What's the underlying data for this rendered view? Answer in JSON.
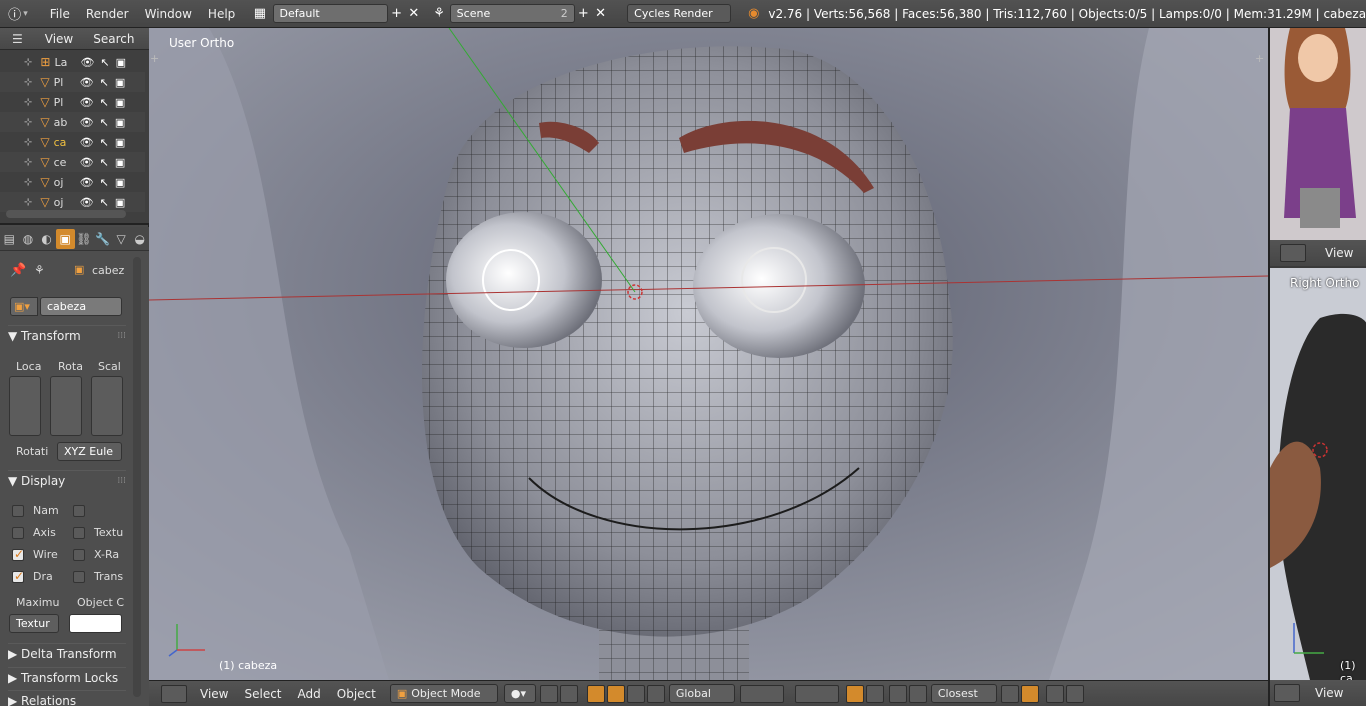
{
  "topbar": {
    "info_icon": "info-icon",
    "menus": [
      "File",
      "Render",
      "Window",
      "Help"
    ],
    "screen_layout": "Default",
    "scene": "Scene",
    "scene_users": "2",
    "render_engine": "Cycles Render",
    "stats": "v2.76 | Verts:56,568 | Faces:56,380 | Tris:112,760 | Objects:0/5 | Lamps:0/0 | Mem:31.29M | cabeza"
  },
  "outliner": {
    "menus": [
      "View",
      "Search"
    ],
    "rows": [
      {
        "name": "La",
        "type": "lamp"
      },
      {
        "name": "Pl",
        "type": "mesh"
      },
      {
        "name": "Pl",
        "type": "mesh"
      },
      {
        "name": "ab",
        "type": "mesh"
      },
      {
        "name": "ca",
        "type": "mesh",
        "active": true
      },
      {
        "name": "ce",
        "type": "mesh"
      },
      {
        "name": "oj",
        "type": "mesh"
      },
      {
        "name": "oj",
        "type": "mesh"
      }
    ]
  },
  "properties": {
    "context_object": "cabez",
    "object_name": "cabeza",
    "transform_title": "Transform",
    "transform_cols": [
      "Loca",
      "Rota",
      "Scal"
    ],
    "rotation_label": "Rotati",
    "rotation_mode": "XYZ Eule",
    "display_title": "Display",
    "display_options": [
      {
        "label": "Nam",
        "checked": false
      },
      {
        "label": "Axis",
        "checked": false
      },
      {
        "label": "Wire",
        "checked": true
      },
      {
        "label": "Dra",
        "checked": true
      }
    ],
    "display_options_right": [
      {
        "label": "",
        "checked": false
      },
      {
        "label": "Textu",
        "checked": false
      },
      {
        "label": "X-Ra",
        "checked": false
      },
      {
        "label": "Trans",
        "checked": false
      }
    ],
    "maximum_label": "Maximu",
    "object_color_label": "Object C",
    "maximum_value": "Textur",
    "delta_transform_title": "Delta Transform",
    "transform_locks_title": "Transform Locks",
    "relations_title": "Relations"
  },
  "viewport": {
    "view_label": "User Ortho",
    "object_label": "(1) cabeza",
    "header": {
      "menus": [
        "View",
        "Select",
        "Add",
        "Object"
      ],
      "mode": "Object Mode",
      "orientation": "Global",
      "snap_target": "Closest"
    }
  },
  "right_panel": {
    "top_menu": "View",
    "view_label": "Right Ortho",
    "object_label": "(1) ca",
    "bottom_menu": "View"
  },
  "colors": {
    "accent": "#d38a2c",
    "viewport_bg": "#8c8f9c"
  }
}
